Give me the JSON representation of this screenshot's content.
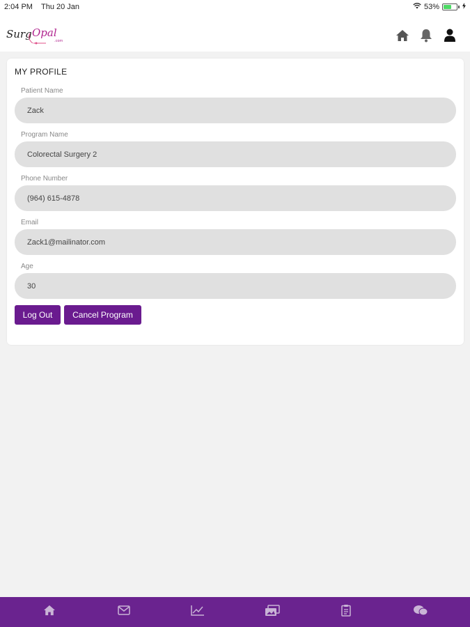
{
  "status_bar": {
    "time": "2:04 PM",
    "date": "Thu 20 Jan",
    "battery": "53%",
    "battery_level": 0.53
  },
  "header": {
    "logo_text": "SurgOpal",
    "logo_suffix": ".com"
  },
  "profile": {
    "title": "MY PROFILE",
    "fields": [
      {
        "label": "Patient Name",
        "value": "Zack"
      },
      {
        "label": "Program Name",
        "value": "Colorectal Surgery 2"
      },
      {
        "label": "Phone Number",
        "value": "(964) 615-4878"
      },
      {
        "label": "Email",
        "value": "Zack1@mailinator.com"
      },
      {
        "label": "Age",
        "value": "30"
      }
    ],
    "logout_label": "Log Out",
    "cancel_label": "Cancel Program"
  },
  "colors": {
    "accent": "#6a1b8f",
    "nav_bg": "#6a238f",
    "field_bg": "#e0e0e0",
    "page_bg": "#f2f2f2"
  },
  "icons": {
    "header": [
      "home-icon",
      "bell-icon",
      "user-icon"
    ],
    "bottom_nav": [
      "home-icon",
      "mail-icon",
      "chart-icon",
      "gallery-icon",
      "clipboard-icon",
      "chat-icon"
    ]
  }
}
